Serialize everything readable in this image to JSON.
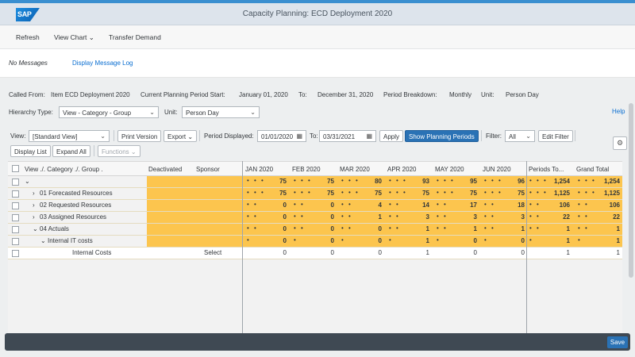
{
  "shell": {
    "logo": "SAP",
    "title": "Capacity Planning: ECD Deployment 2020"
  },
  "toolbar": {
    "refresh": "Refresh",
    "view_chart": "View Chart",
    "transfer": "Transfer Demand"
  },
  "messages": {
    "no_messages": "No Messages",
    "display_log": "Display Message Log"
  },
  "info": {
    "called_from_label": "Called From:",
    "called_from": "Item ECD Deployment 2020",
    "period_start_label": "Current Planning Period Start:",
    "period_start": "January 01, 2020",
    "to_label": "To:",
    "period_end": "December 31, 2020",
    "breakdown_label": "Period Breakdown:",
    "breakdown": "Monthly",
    "unit_label": "Unit:",
    "unit": "Person Day"
  },
  "filters": {
    "hierarchy_label": "Hierarchy Type:",
    "hierarchy": "View - Category - Group",
    "unit_label": "Unit:",
    "unit": "Person Day",
    "help": "Help"
  },
  "controls": {
    "view_label": "View:",
    "view": "[Standard View]",
    "print_version": "Print Version",
    "export": "Export",
    "period_displayed_label": "Period Displayed:",
    "period_from": "01/01/2020",
    "to_label": "To:",
    "period_to": "03/31/2021",
    "apply": "Apply",
    "show_planning_periods": "Show Planning Periods",
    "filter_label": "Filter:",
    "filter": "All",
    "edit_filter": "Edit Filter",
    "display_list": "Display List",
    "expand_all": "Expand All",
    "functions": "Functions"
  },
  "grid": {
    "headers": [
      "View ./. Category ./. Group .",
      "Deactivated",
      "Sponsor",
      "JAN 2020",
      "FEB 2020",
      "MAR 2020",
      "APR 2020",
      "MAY 2020",
      "JUN 2020",
      "Periods To...",
      "Grand Total"
    ],
    "rows": [
      {
        "name": "",
        "expander": "⌄",
        "indent": 0,
        "sponsor": "",
        "values": [
          "75",
          "75",
          "80",
          "93",
          "95",
          "96",
          "1,254",
          "1,254"
        ],
        "highlight": true
      },
      {
        "name": "01 Forecasted Resources",
        "expander": "›",
        "indent": 1,
        "sponsor": "",
        "values": [
          "75",
          "75",
          "75",
          "75",
          "75",
          "75",
          "1,125",
          "1,125"
        ],
        "highlight": true
      },
      {
        "name": "02 Requested Resources",
        "expander": "›",
        "indent": 1,
        "sponsor": "",
        "values": [
          "0",
          "0",
          "4",
          "14",
          "17",
          "18",
          "106",
          "106"
        ],
        "highlight": true
      },
      {
        "name": "03 Assigned Resources",
        "expander": "›",
        "indent": 1,
        "sponsor": "",
        "values": [
          "0",
          "0",
          "1",
          "3",
          "3",
          "3",
          "22",
          "22"
        ],
        "highlight": true
      },
      {
        "name": "04 Actuals",
        "expander": "⌄",
        "indent": 1,
        "sponsor": "",
        "values": [
          "0",
          "0",
          "0",
          "1",
          "1",
          "1",
          "1",
          "1"
        ],
        "highlight": true
      },
      {
        "name": "Internal IT costs",
        "expander": "⌄",
        "indent": 2,
        "sponsor": "",
        "values": [
          "0",
          "0",
          "0",
          "1",
          "0",
          "0",
          "1",
          "1"
        ],
        "highlight": true
      },
      {
        "name": "Internal Costs",
        "expander": "",
        "indent": 3,
        "sponsor": "Select",
        "values": [
          "0",
          "0",
          "0",
          "1",
          "0",
          "0",
          "1",
          "1"
        ],
        "highlight": false
      }
    ]
  },
  "footer": {
    "save": "Save"
  },
  "colors": {
    "accent": "#2a72b5",
    "highlight": "#fcc54e",
    "footer": "#3f4953"
  }
}
